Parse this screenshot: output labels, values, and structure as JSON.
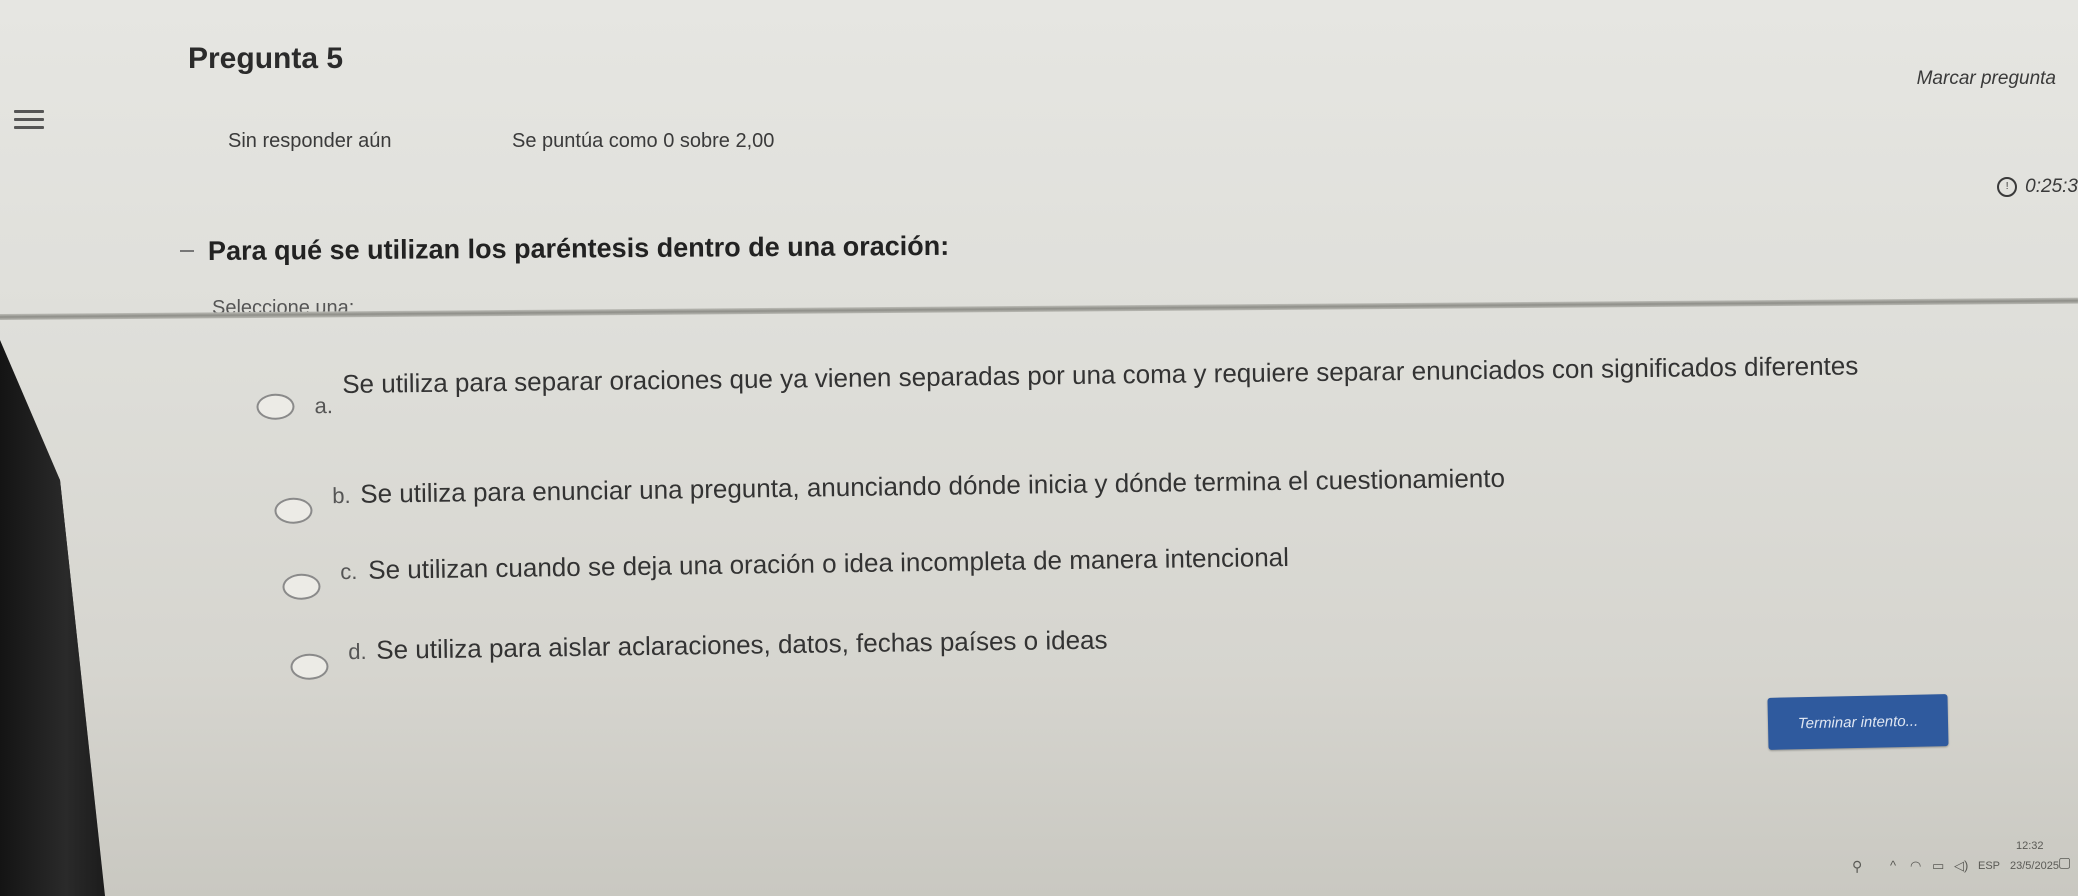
{
  "header": {
    "question_title": "Pregunta 5",
    "flag_label": "Marcar pregunta",
    "status": "Sin responder aún",
    "grade": "Se puntúa como 0 sobre 2,00"
  },
  "timer": {
    "icon": "clock-icon",
    "value": "0:25:3"
  },
  "question": {
    "text": "Para qué se utilizan los paréntesis dentro de una oración:",
    "instruction": "Seleccione una:"
  },
  "options": [
    {
      "letter": "a.",
      "text": "Se utiliza para separar oraciones que ya vienen separadas por una coma y requiere separar enunciados con significados diferentes"
    },
    {
      "letter": "b.",
      "text": "Se utiliza para enunciar una pregunta, anunciando dónde inicia y dónde termina el cuestionamiento"
    },
    {
      "letter": "c.",
      "text": "Se utilizan cuando se deja una oración o idea incompleta de manera intencional"
    },
    {
      "letter": "d.",
      "text": "Se utiliza para aislar aclaraciones, datos, fechas países o ideas"
    }
  ],
  "finish_button": "Terminar intento...",
  "taskbar": {
    "language": "ESP",
    "time": "12:32",
    "date": "23/5/2025",
    "icons": [
      "people-icon",
      "chevron-up-icon",
      "wifi-icon",
      "battery-icon",
      "volume-icon",
      "notification-icon"
    ]
  }
}
